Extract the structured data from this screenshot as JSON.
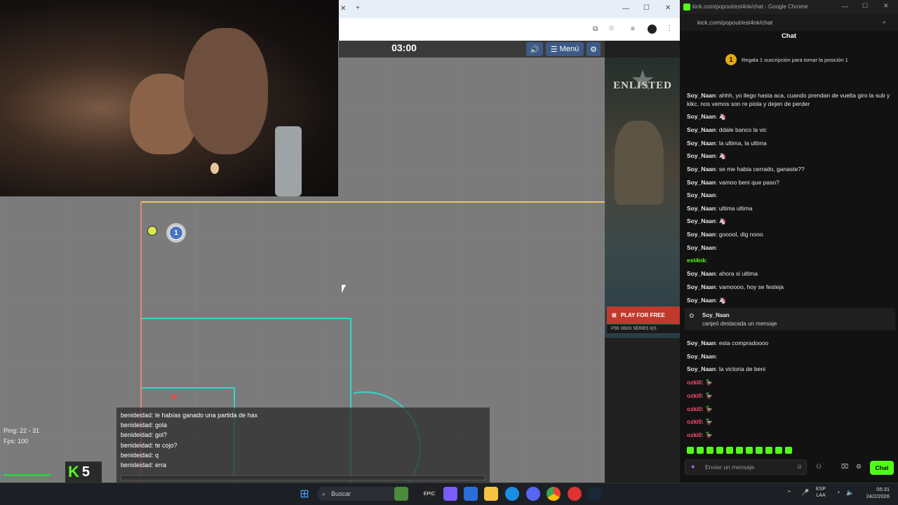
{
  "game": {
    "timer": "03:00",
    "menu_label": "Menú",
    "player_number": "1",
    "ping": "Ping: 22 - 31",
    "fps": "Fps: 100",
    "score": "5",
    "chat_log": [
      "benideidad: le habías ganado una partida de hax",
      "benideidad: gola",
      "benideidad: gol?",
      "benideidad: te cojo?",
      "benideidad: q",
      "benideidad: erra"
    ]
  },
  "ad": {
    "brand": "ENLISTED",
    "cta": "PLAY FOR FREE",
    "platforms": "PS5   XBOX SERIES X|S"
  },
  "chat_window": {
    "url_title": "kick.com/popout/est4nk/chat - Google Chrome",
    "address": "kick.com/popout/est4nk/chat",
    "header": "Chat",
    "pinned_banner": "Regala 1 suscripción para tomar la posición 1",
    "messages": [
      {
        "user": "Soy_Naan",
        "text": "ahhh, yo llego hasta aca, cuando prendan de vuelta giro la sub y kikc. nos vemos son re piola y dejen de perder"
      },
      {
        "user": "Soy_Naan",
        "text": "🦄"
      },
      {
        "user": "Soy_Naan",
        "text": "ddale banco la vic"
      },
      {
        "user": "Soy_Naan",
        "text": "la ultima, la ultima"
      },
      {
        "user": "Soy_Naan",
        "text": "🦄"
      },
      {
        "user": "Soy_Naan",
        "text": "se me habia cerrado, ganaste??"
      },
      {
        "user": "Soy_Naan",
        "text": "vamoo beni que paso?"
      },
      {
        "user": "Soy_Naan",
        "text": ""
      },
      {
        "user": "Soy_Naan",
        "text": "ultima ultima"
      },
      {
        "user": "Soy_Naan",
        "text": "🦄"
      },
      {
        "user": "Soy_Naan",
        "text": "gooool, dig nooo"
      },
      {
        "user": "Soy_Naan",
        "text": ""
      },
      {
        "user": "est4nk",
        "text": ""
      },
      {
        "user": "Soy_Naan",
        "text": "ahora si ultima"
      },
      {
        "user": "Soy_Naan",
        "text": "vamoooo, hoy se festeja"
      },
      {
        "user": "Soy_Naan",
        "text": "🦄"
      }
    ],
    "highlight": {
      "user": "Soy_Naan",
      "text": "canjeó destacada un mensaje"
    },
    "messages_after": [
      {
        "user": "Soy_Naan",
        "text": "esta compradoooo"
      },
      {
        "user": "Soy_Naan",
        "text": ""
      },
      {
        "user": "Soy_Naan",
        "text": "la victoria de beni"
      },
      {
        "user": "ozki0",
        "text": "🦆"
      },
      {
        "user": "ozki0",
        "text": "🦆"
      },
      {
        "user": "ozki0",
        "text": "🦆"
      },
      {
        "user": "ozki0",
        "text": "🦆"
      },
      {
        "user": "ozki0",
        "text": "🦆"
      }
    ],
    "input_placeholder": "Enviar un mensaje",
    "send_label": "Chat"
  },
  "taskbar": {
    "search_label": "Buscar",
    "lang": "ESP",
    "region": "LAA",
    "time": "05:31",
    "date": "24/2/2026"
  },
  "colors": {
    "kick_green": "#53fc18",
    "field_line": "#36d6c8",
    "chat_bg": "#121212",
    "user_soy": "#e8e8e8",
    "user_ozki": "#ff4d6d"
  }
}
